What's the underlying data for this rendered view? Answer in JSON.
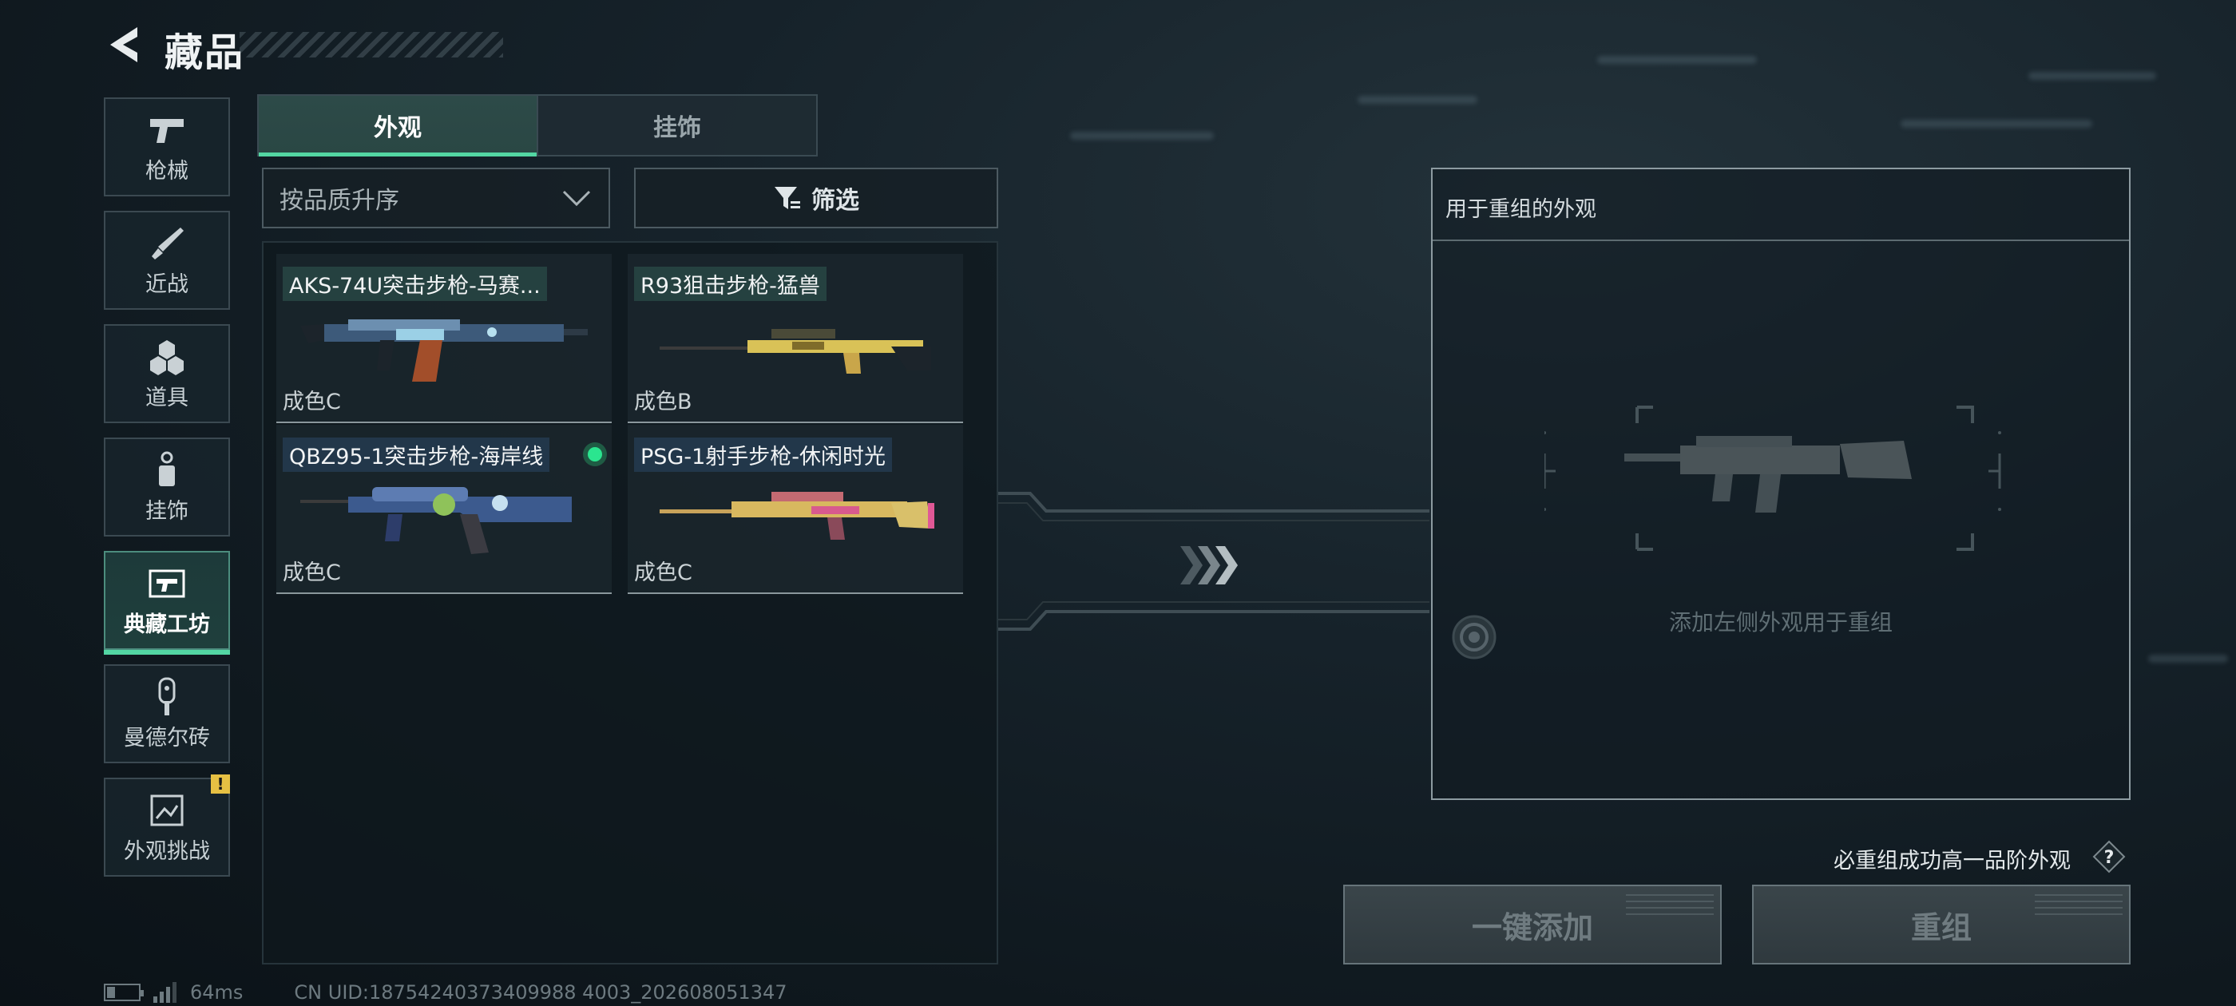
{
  "header": {
    "title": "藏品"
  },
  "sidebar": {
    "items": [
      {
        "label": "枪械",
        "icon": "pistol-icon"
      },
      {
        "label": "近战",
        "icon": "knife-icon"
      },
      {
        "label": "道具",
        "icon": "cubes-icon"
      },
      {
        "label": "挂饰",
        "icon": "charm-icon"
      },
      {
        "label": "典藏工坊",
        "icon": "workshop-icon",
        "active": true
      },
      {
        "label": "曼德尔砖",
        "icon": "mandel-brick-icon"
      },
      {
        "label": "外观挑战",
        "icon": "challenge-icon",
        "badge": "!"
      }
    ]
  },
  "tabs": [
    {
      "label": "外观",
      "active": true
    },
    {
      "label": "挂饰",
      "active": false
    }
  ],
  "sort": {
    "value": "按品质升序"
  },
  "filter": {
    "label": "筛选"
  },
  "items": [
    {
      "name": "AKS-74U突击步枪-马赛...",
      "grade": "成色C",
      "equipped": false
    },
    {
      "name": "R93狙击步枪-猛兽",
      "grade": "成色B",
      "equipped": false
    },
    {
      "name": "QBZ95-1突击步枪-海岸线",
      "grade": "成色C",
      "equipped": true
    },
    {
      "name": "PSG-1射手步枪-休闲时光",
      "grade": "成色C",
      "equipped": false
    }
  ],
  "recombine": {
    "title": "用于重组的外观",
    "placeholder": "添加左侧外观用于重组"
  },
  "guarantee": {
    "text": "必重组成功高一品阶外观",
    "help": "?"
  },
  "buttons": {
    "quick_add": "一键添加",
    "recombine": "重组"
  },
  "status": {
    "ping": "64ms",
    "uid": "CN UID:18754240373409988 4003_202608051347"
  },
  "colors": {
    "accent": "#53d6a3",
    "equipped": "#2be58f",
    "warning": "#e6c043"
  }
}
